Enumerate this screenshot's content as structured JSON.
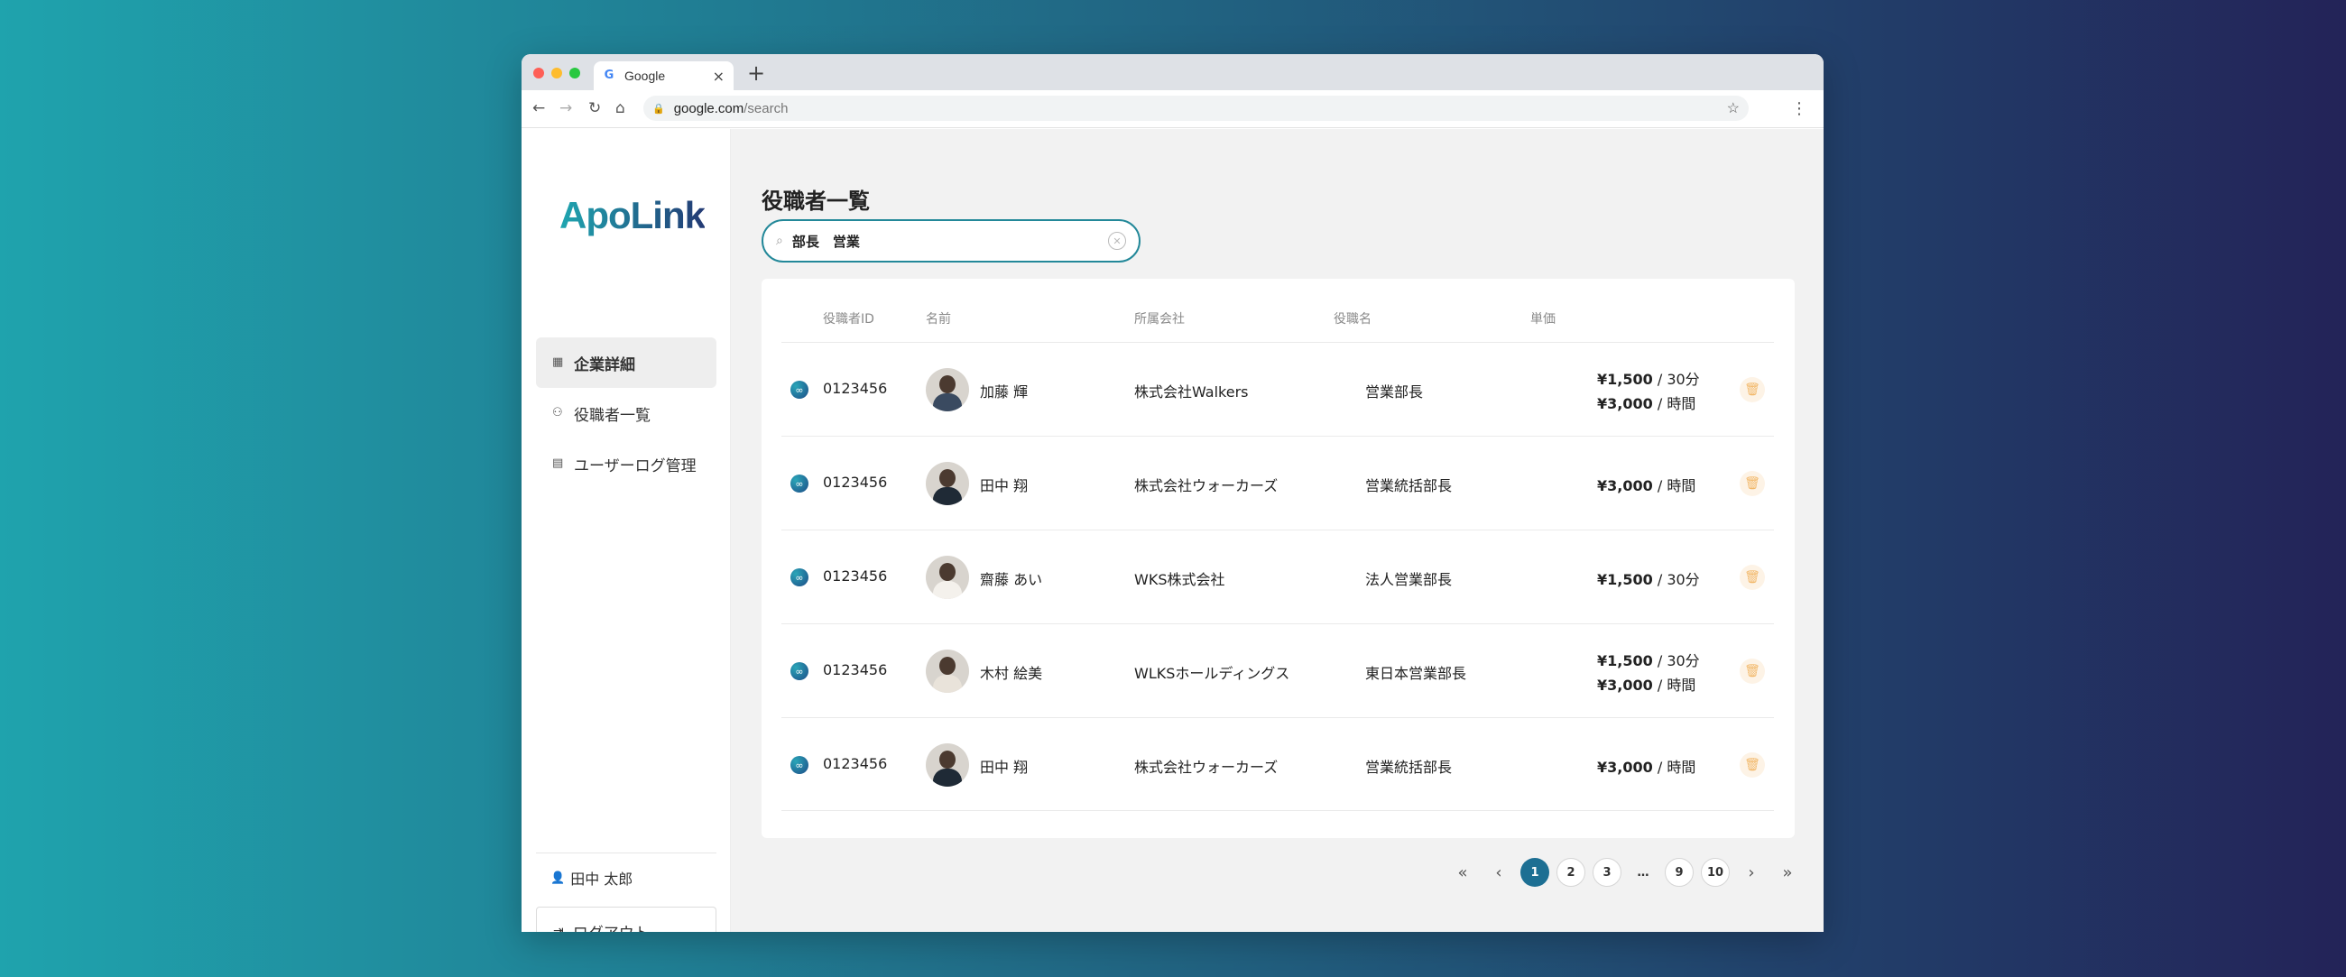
{
  "browser": {
    "tab_title": "Google",
    "tab_icon": "G",
    "tab_close": "×",
    "new_tab": "+",
    "url_host": "google.com",
    "url_path": "/search"
  },
  "sidebar": {
    "logo": "ApoLink",
    "items": [
      {
        "label": "企業詳細",
        "icon": "building-icon"
      },
      {
        "label": "役職者一覧",
        "icon": "people-icon"
      },
      {
        "label": "ユーザーログ管理",
        "icon": "log-icon"
      }
    ],
    "user_name": "田中 太郎",
    "logout_label": "ログアウト"
  },
  "main": {
    "title": "役職者一覧",
    "search_value": "部長　営業",
    "columns": [
      "役職者ID",
      "名前",
      "所属会社",
      "役職名",
      "単価"
    ],
    "rows": [
      {
        "id": "0123456",
        "name": "加藤 輝",
        "company": "株式会社Walkers",
        "position": "営業部長",
        "price1_amount": "¥1,500",
        "price1_unit": " / 30分",
        "price2_amount": "¥3,000",
        "price2_unit": " / 時間"
      },
      {
        "id": "0123456",
        "name": "田中 翔",
        "company": "株式会社ウォーカーズ",
        "position": "営業統括部長",
        "price1_amount": "¥3,000",
        "price1_unit": " / 時間"
      },
      {
        "id": "0123456",
        "name": "齋藤 あい",
        "company": "WKS株式会社",
        "position": "法人営業部長",
        "price1_amount": "¥1,500",
        "price1_unit": " / 30分"
      },
      {
        "id": "0123456",
        "name": "木村 絵美",
        "company": "WLKSホールディングス",
        "position": "東日本営業部長",
        "price1_amount": "¥1,500",
        "price1_unit": " / 30分",
        "price2_amount": "¥3,000",
        "price2_unit": " / 時間"
      },
      {
        "id": "0123456",
        "name": "田中 翔",
        "company": "株式会社ウォーカーズ",
        "position": "営業統括部長",
        "price1_amount": "¥3,000",
        "price1_unit": " / 時間"
      }
    ]
  },
  "pagination": {
    "first": "«",
    "prev": "‹",
    "pages": [
      "1",
      "2",
      "3",
      "…",
      "9",
      "10"
    ],
    "current": "1",
    "next": "›",
    "last": "»"
  },
  "colors": {
    "accent": "#1d6f93",
    "search_border": "#238899",
    "trash_icon": "#f2b86a"
  }
}
